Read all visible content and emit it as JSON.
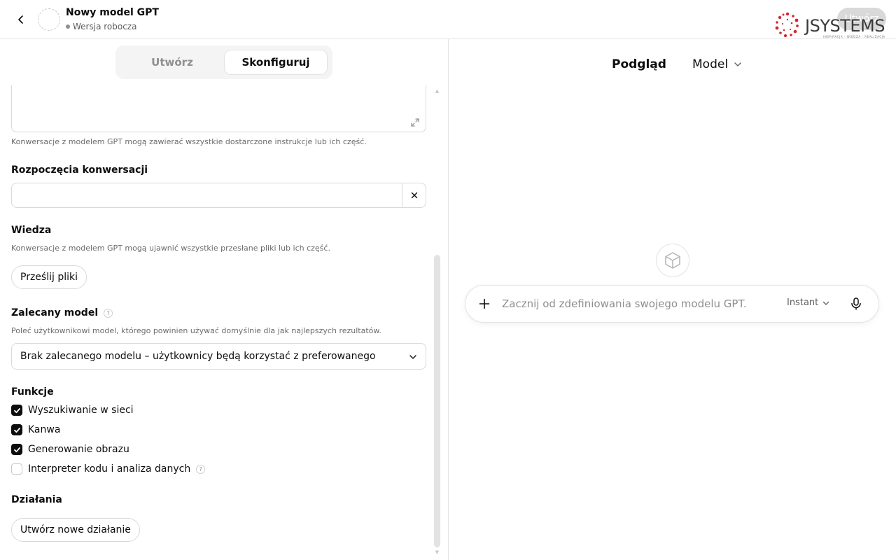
{
  "header": {
    "gpt_name": "Nowy model GPT",
    "status": "Wersja robocza",
    "create_button": "Utwórz",
    "logo_text": "JSYSTEMS",
    "logo_tagline": "INSPIRACJA · WIEDZA · REALIZACJA"
  },
  "editor": {
    "tabs": [
      {
        "label": "Utwórz",
        "active": false
      },
      {
        "label": "Skonfiguruj",
        "active": true
      }
    ],
    "instructions_hint": "Konwersacje z modelem GPT mogą zawierać wszystkie dostarczone instrukcje lub ich część.",
    "conversation_starters": {
      "label": "Rozpoczęcia konwersacji",
      "value": ""
    },
    "knowledge": {
      "label": "Wiedza",
      "hint": "Konwersacje z modelem GPT mogą ujawnić wszystkie przesłane pliki lub ich część.",
      "upload_button": "Prześlij pliki"
    },
    "recommended_model": {
      "label": "Zalecany model",
      "hint": "Poleć użytkownikowi model, którego powinien używać domyślnie dla jak najlepszych rezultatów.",
      "selected": "Brak zalecanego modelu – użytkownicy będą korzystać z preferowanego"
    },
    "capabilities": {
      "label": "Funkcje",
      "items": [
        {
          "label": "Wyszukiwanie w sieci",
          "checked": true
        },
        {
          "label": "Kanwa",
          "checked": true
        },
        {
          "label": "Generowanie obrazu",
          "checked": true
        },
        {
          "label": "Interpreter kodu i analiza danych",
          "checked": false
        }
      ]
    },
    "actions": {
      "label": "Działania",
      "create_button": "Utwórz nowe działanie"
    }
  },
  "preview": {
    "title": "Podgląd",
    "model_menu": "Model",
    "composer_placeholder": "Zacznij od zdefiniowania swojego modelu GPT.",
    "mode": "Instant"
  },
  "colors": {
    "text": "#0d0d0d",
    "muted": "#8f8f8f",
    "border": "#d9d9d9",
    "checkbox_on": "#0d0d0d",
    "logo_red": "#d7262d"
  }
}
